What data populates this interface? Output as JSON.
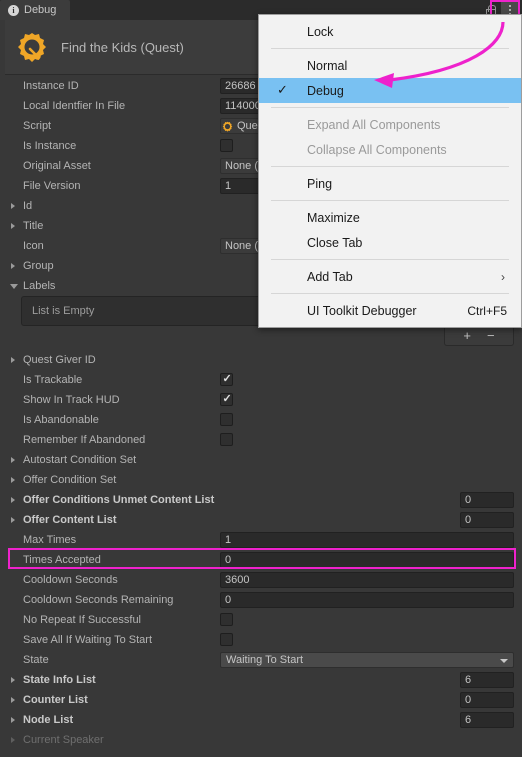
{
  "window": {
    "tab_label": "Debug",
    "tab_icon": "info-icon",
    "lock_icon": "lock-icon",
    "menu_icon": "kebab-menu-icon"
  },
  "object_header": {
    "title": "Find the Kids (Quest)",
    "icon": "quest-gear-icon"
  },
  "properties": [
    {
      "label": "Instance ID",
      "type": "text",
      "value": "26686"
    },
    {
      "label": "Local Identfier In File",
      "type": "text",
      "value": "114000"
    },
    {
      "label": "Script",
      "type": "object",
      "value": "Ques"
    },
    {
      "label": "Is Instance",
      "type": "checkbox",
      "checked": false
    },
    {
      "label": "Original Asset",
      "type": "object",
      "value": "None ("
    },
    {
      "label": "File Version",
      "type": "text",
      "value": "1"
    },
    {
      "label": "Id",
      "type": "foldout",
      "value": ""
    },
    {
      "label": "Title",
      "type": "foldout",
      "value": ""
    },
    {
      "label": "Icon",
      "type": "object",
      "value": "None ("
    },
    {
      "label": "Group",
      "type": "foldout",
      "value": ""
    }
  ],
  "labels_section": {
    "label": "Labels",
    "expanded": true,
    "count": "0",
    "empty_text": "List is Empty",
    "add_button": "+",
    "remove_button": "−"
  },
  "properties_2": [
    {
      "label": "Quest Giver ID",
      "type": "foldout",
      "value": ""
    },
    {
      "label": "Is Trackable",
      "type": "checkbox",
      "checked": true
    },
    {
      "label": "Show In Track HUD",
      "type": "checkbox",
      "checked": true
    },
    {
      "label": "Is Abandonable",
      "type": "checkbox",
      "checked": false
    },
    {
      "label": "Remember If Abandoned",
      "type": "checkbox",
      "checked": false
    },
    {
      "label": "Autostart Condition Set",
      "type": "foldout",
      "value": ""
    },
    {
      "label": "Offer Condition Set",
      "type": "foldout",
      "value": ""
    },
    {
      "label": "Offer Conditions Unmet Content List",
      "type": "foldout-count",
      "bold": true,
      "value": "0"
    },
    {
      "label": "Offer Content List",
      "type": "foldout-count",
      "bold": true,
      "value": "0"
    },
    {
      "label": "Max Times",
      "type": "text",
      "value": "1"
    },
    {
      "label": "Times Accepted",
      "type": "text",
      "value": "0",
      "highlighted": true
    },
    {
      "label": "Cooldown Seconds",
      "type": "text",
      "value": "3600"
    },
    {
      "label": "Cooldown Seconds Remaining",
      "type": "text",
      "value": "0"
    },
    {
      "label": "No Repeat If Successful",
      "type": "checkbox",
      "checked": false
    },
    {
      "label": "Save All If Waiting To Start",
      "type": "checkbox",
      "checked": false
    },
    {
      "label": "State",
      "type": "popup",
      "value": "Waiting To Start"
    },
    {
      "label": "State Info List",
      "type": "foldout-count",
      "bold": true,
      "value": "6"
    },
    {
      "label": "Counter List",
      "type": "foldout-count",
      "bold": true,
      "value": "0"
    },
    {
      "label": "Node List",
      "type": "foldout-count",
      "bold": true,
      "value": "6"
    },
    {
      "label": "Current Speaker",
      "type": "foldout",
      "value": "",
      "disabled": true
    }
  ],
  "context_menu": {
    "items": [
      {
        "label": "Lock",
        "type": "item"
      },
      {
        "type": "separator"
      },
      {
        "label": "Normal",
        "type": "item"
      },
      {
        "label": "Debug",
        "type": "item",
        "selected": true,
        "checked": true
      },
      {
        "type": "separator"
      },
      {
        "label": "Expand All Components",
        "type": "item",
        "disabled": true
      },
      {
        "label": "Collapse All Components",
        "type": "item",
        "disabled": true
      },
      {
        "type": "separator"
      },
      {
        "label": "Ping",
        "type": "item"
      },
      {
        "type": "separator"
      },
      {
        "label": "Maximize",
        "type": "item"
      },
      {
        "label": "Close Tab",
        "type": "item"
      },
      {
        "type": "separator"
      },
      {
        "label": "Add Tab",
        "type": "item",
        "submenu": "›"
      },
      {
        "type": "separator"
      },
      {
        "label": "UI Toolkit Debugger",
        "type": "item",
        "shortcut": "Ctrl+F5"
      }
    ]
  },
  "annotations": {
    "highlight_color": "#ee22cc",
    "arrow_from": "kebab-menu-icon",
    "arrow_to": "Debug"
  }
}
